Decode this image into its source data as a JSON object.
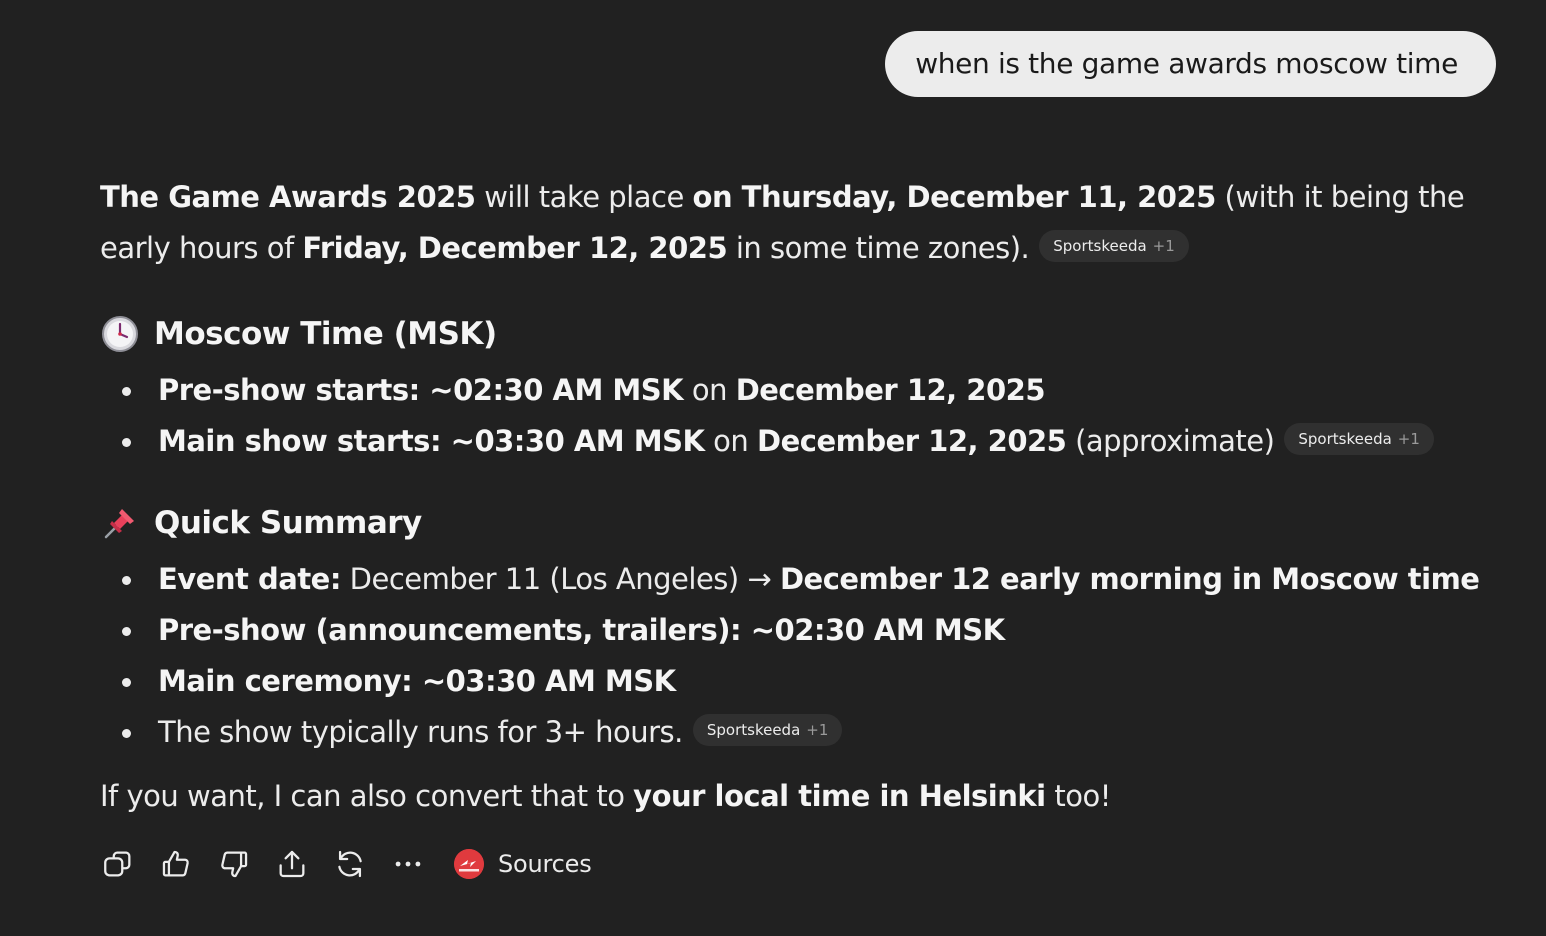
{
  "user_message": "when is the game awards moscow time",
  "intro": {
    "p1": "The Game Awards 2025",
    "p2": " will take place ",
    "p3": "on Thursday, December 11, 2025",
    "p4": " (with it being the early hours of ",
    "p5": "Friday, December 12, 2025",
    "p6": " in some time zones).",
    "chip": {
      "source": "Sportskeeda",
      "more": "+1"
    }
  },
  "moscow_section": {
    "emoji": "clock-icon",
    "heading": "Moscow Time (MSK)",
    "items": [
      {
        "a": "Pre-show starts: ~02:30 AM MSK",
        "b": " on ",
        "c": "December 12, 2025",
        "d": ""
      },
      {
        "a": "Main show starts: ~03:30 AM MSK",
        "b": " on ",
        "c": "December 12, 2025",
        "d": " (approximate)"
      }
    ],
    "chip": {
      "source": "Sportskeeda",
      "more": "+1"
    }
  },
  "summary_section": {
    "emoji": "pushpin-icon",
    "heading": "Quick Summary",
    "items": [
      {
        "a": "Event date:",
        "b": " December 11 (Los Angeles) → ",
        "c": "December 12 early morning in Moscow time"
      },
      {
        "a": "Pre-show (announcements, trailers): ~02:30 AM MSK",
        "b": "",
        "c": ""
      },
      {
        "a": "Main ceremony: ~03:30 AM MSK",
        "b": "",
        "c": ""
      },
      {
        "a": "",
        "b": "The show typically runs for 3+ hours.",
        "c": ""
      }
    ],
    "chip": {
      "source": "Sportskeeda",
      "more": "+1"
    }
  },
  "closing": {
    "p1": "If you want, I can also convert that to ",
    "p2": "your local time in Helsinki",
    "p3": " too!"
  },
  "actions": {
    "icons": [
      "copy-icon",
      "thumbs-up-icon",
      "thumbs-down-icon",
      "share-icon",
      "regenerate-icon",
      "more-icon"
    ],
    "sources_label": "Sources"
  },
  "colors": {
    "background": "#212121",
    "bubble": "#ececec",
    "chip": "#303030",
    "source_logo": "#e03a3e"
  }
}
